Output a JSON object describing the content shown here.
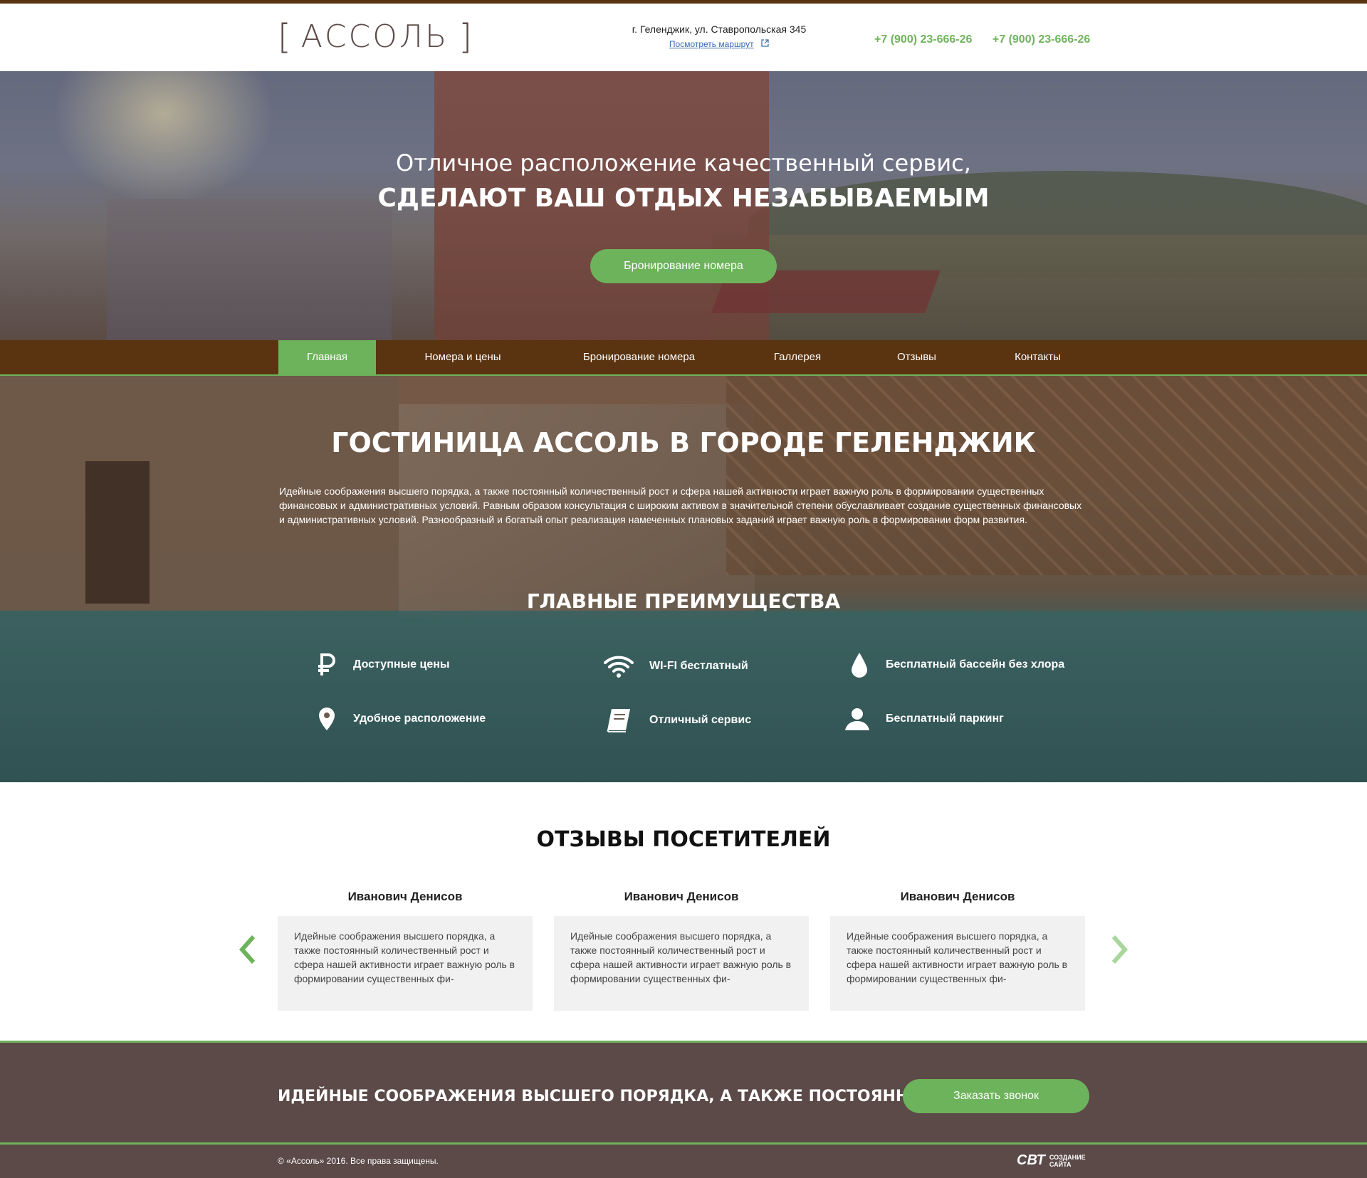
{
  "header": {
    "logo_bracket_left": "[",
    "logo_name": "АССОЛЬ",
    "logo_bracket_right": "]",
    "address": "г. Геленджик, ул. Ставропольская 345",
    "route_link": "Посмотреть маршрут",
    "phones": [
      "+7 (900) 23-666-26",
      "+7 (900) 23-666-26"
    ]
  },
  "hero": {
    "subtitle": "Отличное расположение  качественный сервис,",
    "title": "СДЕЛАЮТ ВАШ ОТДЫХ НЕЗАБЫВАЕМЫМ",
    "button": "Бронирование номера"
  },
  "nav": {
    "items": [
      {
        "label": "Главная",
        "active": true
      },
      {
        "label": "Номера и цены",
        "active": false
      },
      {
        "label": "Бронирование  номера",
        "active": false
      },
      {
        "label": "Галлерея",
        "active": false
      },
      {
        "label": "Отзывы",
        "active": false
      },
      {
        "label": "Контакты",
        "active": false
      }
    ]
  },
  "about": {
    "title": "ГОСТИНИЦА АССОЛЬ В ГОРОДЕ ГЕЛЕНДЖИК",
    "text": "Идейные соображения высшего порядка, а также постоянный количественный рост и сфера нашей активности играет важную роль в формировании существенных финансовых и административных условий. Равным образом консультация с широким активом в значительной степени обуславливает создание существенных финансовых и административных условий. Разнообразный и богатый опыт реализация намеченных плановых заданий играет важную роль в формировании форм развития."
  },
  "advantages": {
    "title": "ГЛАВНЫЕ ПРЕИМУЩЕСТВА",
    "items": [
      {
        "icon": "ruble-icon",
        "label": "Доступные цены"
      },
      {
        "icon": "wifi-icon",
        "label": "WI-FI бестлатный"
      },
      {
        "icon": "water-drop-icon",
        "label": "Бесплатный бассейн без хлора"
      },
      {
        "icon": "location-pin-icon",
        "label": "Удобное расположение"
      },
      {
        "icon": "book-icon",
        "label": "Отличный сервис"
      },
      {
        "icon": "person-icon",
        "label": "Бесплатный паркинг"
      }
    ]
  },
  "reviews": {
    "title": "ОТЗЫВЫ ПОСЕТИТЕЛЕЙ",
    "items": [
      {
        "name": "Иванович Денисов",
        "text": "Идейные соображения высшего порядка, а также постоянный количественный рост и сфера нашей активности играет важную роль в формировании существенных фи-"
      },
      {
        "name": "Иванович Денисов",
        "text": "Идейные соображения высшего порядка, а также постоянный количественный рост и сфера нашей активности играет важную роль в формировании существенных фи-"
      },
      {
        "name": "Иванович Денисов",
        "text": "Идейные соображения высшего порядка, а также постоянный количественный рост и сфера нашей активности играет важную роль в формировании существенных фи-"
      }
    ]
  },
  "callback": {
    "text": "ИДЕЙНЫЕ СООБРАЖЕНИЯ ВЫСШЕГО ПОРЯДКА, А ТАКЖЕ ПОСТОЯННЫЙ",
    "button": "Заказать звонок"
  },
  "footer": {
    "copyright": "© «Ассоль» 2016. Все права защищены.",
    "maker_logo": "СВТ",
    "maker_text_1": "СОЗДАНИЕ",
    "maker_text_2": "САЙТА"
  },
  "colors": {
    "accent_green": "#6db35b",
    "nav_brown": "#5a3310",
    "band_brown": "#5b4a48"
  }
}
